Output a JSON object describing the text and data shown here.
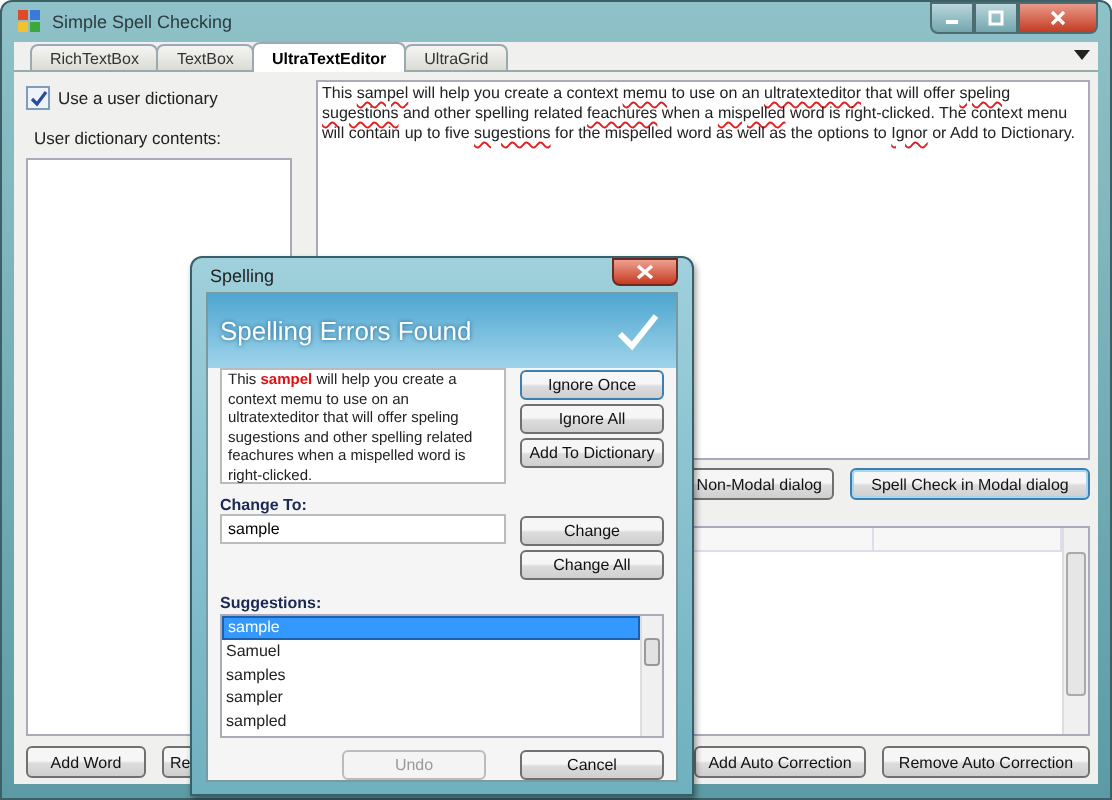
{
  "window": {
    "title": "Simple Spell Checking"
  },
  "tabs": [
    {
      "label": "RichTextBox",
      "selected": false
    },
    {
      "label": "TextBox",
      "selected": false
    },
    {
      "label": "UltraTextEditor",
      "selected": true
    },
    {
      "label": "UltraGrid",
      "selected": false
    }
  ],
  "user_dictionary": {
    "label": "Use a user dictionary",
    "checked": true,
    "contents_label": "User dictionary contents:"
  },
  "editor": {
    "segments": [
      {
        "text": "This ",
        "misspelled": false
      },
      {
        "text": "sampel",
        "misspelled": true
      },
      {
        "text": " will help you create a context ",
        "misspelled": false
      },
      {
        "text": "memu",
        "misspelled": true
      },
      {
        "text": " to use on an ",
        "misspelled": false
      },
      {
        "text": "ultratexteditor",
        "misspelled": true
      },
      {
        "text": " that will offer ",
        "misspelled": false
      },
      {
        "text": "speling ",
        "misspelled": true
      },
      {
        "text": "sugestions",
        "misspelled": true
      },
      {
        "text": " and other spelling related ",
        "misspelled": false
      },
      {
        "text": "feachures",
        "misspelled": true
      },
      {
        "text": " when a ",
        "misspelled": false
      },
      {
        "text": "mispelled",
        "misspelled": true
      },
      {
        "text": " word is right-clicked. The context menu will contain up to five ",
        "misspelled": false
      },
      {
        "text": "sugestions",
        "misspelled": true
      },
      {
        "text": " for the mispelled word as well as the options to ",
        "misspelled": false
      },
      {
        "text": "Ignor",
        "misspelled": true
      },
      {
        "text": " or Add to Dictionary.",
        "misspelled": false
      }
    ]
  },
  "dialog_buttons": [
    "Non-Modal dialog",
    "Spell Check in Modal dialog"
  ],
  "bottom_buttons_left": [
    "Add Word",
    "Re"
  ],
  "bottom_buttons_right": [
    "Add Auto Correction",
    "Remove Auto Correction"
  ],
  "spelling_dialog": {
    "title": "Spelling",
    "header": "Spelling Errors Found",
    "context": [
      {
        "text": "This ",
        "error": false
      },
      {
        "text": "sampel",
        "error": true
      },
      {
        "text": " will help you create a context memu to use on an ultratexteditor that will offer speling sugestions and other spelling related feachures when a mispelled word is right-clicked.",
        "error": false
      }
    ],
    "actions": [
      "Ignore Once",
      "Ignore All",
      "Add To Dictionary"
    ],
    "change_to_label": "Change To:",
    "change_to_value": "sample",
    "change_buttons": [
      "Change",
      "Change All"
    ],
    "suggestions_label": "Suggestions:",
    "suggestions": [
      {
        "text": "sample",
        "selected": true
      },
      {
        "text": "Samuel",
        "selected": false
      },
      {
        "text": "samples",
        "selected": false
      },
      {
        "text": "sampler",
        "selected": false
      },
      {
        "text": "sampled",
        "selected": false
      }
    ],
    "undo": {
      "label": "Undo",
      "disabled": true
    },
    "cancel": "Cancel"
  }
}
